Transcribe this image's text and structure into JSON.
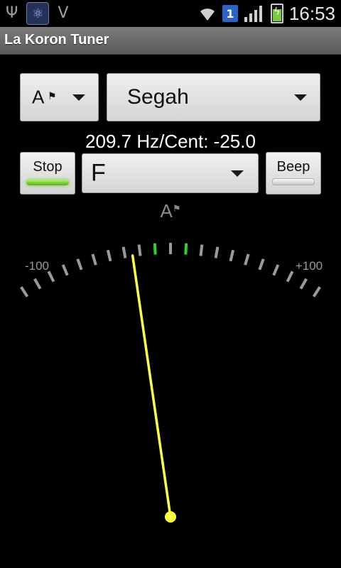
{
  "status_bar": {
    "left_icons": [
      "usb-icon",
      "app-icon",
      "v-icon"
    ],
    "v_label": "V",
    "sim_badge": "1",
    "time": "16:53"
  },
  "app": {
    "title": "La Koron Tuner"
  },
  "controls": {
    "note_name_select": "A",
    "tuning_select": "Segah",
    "frequency_readout": "209.7 Hz/Cent: -25.0",
    "stop_button": "Stop",
    "stop_active": true,
    "key_select": "F",
    "beep_button": "Beep",
    "beep_active": false
  },
  "meter": {
    "note": "A",
    "min_label": "-100",
    "max_label": "+100",
    "range": [
      -100,
      100
    ],
    "cents": -25.0,
    "center_color": "#33cc33",
    "tick_color": "#9a9a9a",
    "needle_color": "#ffff44"
  }
}
